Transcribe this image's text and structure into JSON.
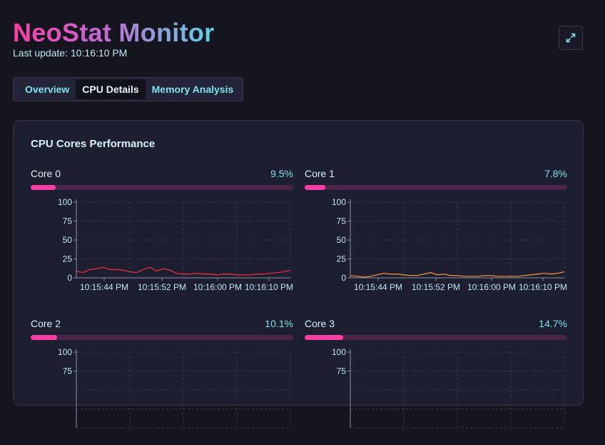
{
  "app": {
    "title": "NeoStat Monitor",
    "last_update": "Last update: 10:16:10 PM"
  },
  "header": {
    "fullscreen_icon": "expand-icon"
  },
  "tabs": [
    {
      "label": "Overview",
      "active": false
    },
    {
      "label": "CPU Details",
      "active": true
    },
    {
      "label": "Memory Analysis",
      "active": false
    }
  ],
  "panel": {
    "title": "CPU Cores Performance"
  },
  "colors": {
    "accent": "#ff3ea5",
    "bar_track": "#4a2548",
    "line_core0": "#e0333f",
    "line_core1": "#e6913b",
    "text_cyan": "#7fe0ee"
  },
  "chart_data": [
    {
      "type": "line",
      "name": "Core 0",
      "percent_label": "9.5%",
      "usage_percent": 9.5,
      "ylim": [
        0,
        100
      ],
      "yticks": [
        "100",
        "75",
        "50",
        "25",
        "0"
      ],
      "xtick_labels": [
        "10:15:44 PM",
        "10:15:52 PM",
        "10:16:00 PM",
        "10:16:10 PM"
      ],
      "series": [
        {
          "values": [
            9,
            7,
            11,
            12,
            14,
            11,
            11,
            10,
            8,
            7,
            11,
            14,
            9,
            12,
            10,
            6,
            5,
            5,
            6,
            5,
            5,
            4,
            5,
            5,
            4,
            4,
            4,
            5,
            5,
            6,
            7,
            8,
            10
          ]
        }
      ]
    },
    {
      "type": "line",
      "name": "Core 1",
      "percent_label": "7.8%",
      "usage_percent": 7.8,
      "ylim": [
        0,
        100
      ],
      "yticks": [
        "100",
        "75",
        "50",
        "25",
        "0"
      ],
      "xtick_labels": [
        "10:15:44 PM",
        "10:15:52 PM",
        "10:16:00 PM",
        "10:16:10 PM"
      ],
      "series": [
        {
          "values": [
            3,
            2,
            1,
            2,
            4,
            6,
            5,
            5,
            4,
            3,
            3,
            5,
            7,
            4,
            5,
            3,
            3,
            2,
            2,
            2,
            3,
            3,
            2,
            2,
            2,
            2,
            3,
            4,
            5,
            6,
            5,
            6,
            8
          ]
        }
      ]
    },
    {
      "type": "line",
      "name": "Core 2",
      "percent_label": "10.1%",
      "usage_percent": 10.1,
      "ylim": [
        0,
        100
      ],
      "yticks": [
        "100",
        "75"
      ],
      "xtick_labels": [],
      "series": []
    },
    {
      "type": "line",
      "name": "Core 3",
      "percent_label": "14.7%",
      "usage_percent": 14.7,
      "ylim": [
        0,
        100
      ],
      "yticks": [
        "100",
        "75"
      ],
      "xtick_labels": [],
      "series": []
    }
  ]
}
